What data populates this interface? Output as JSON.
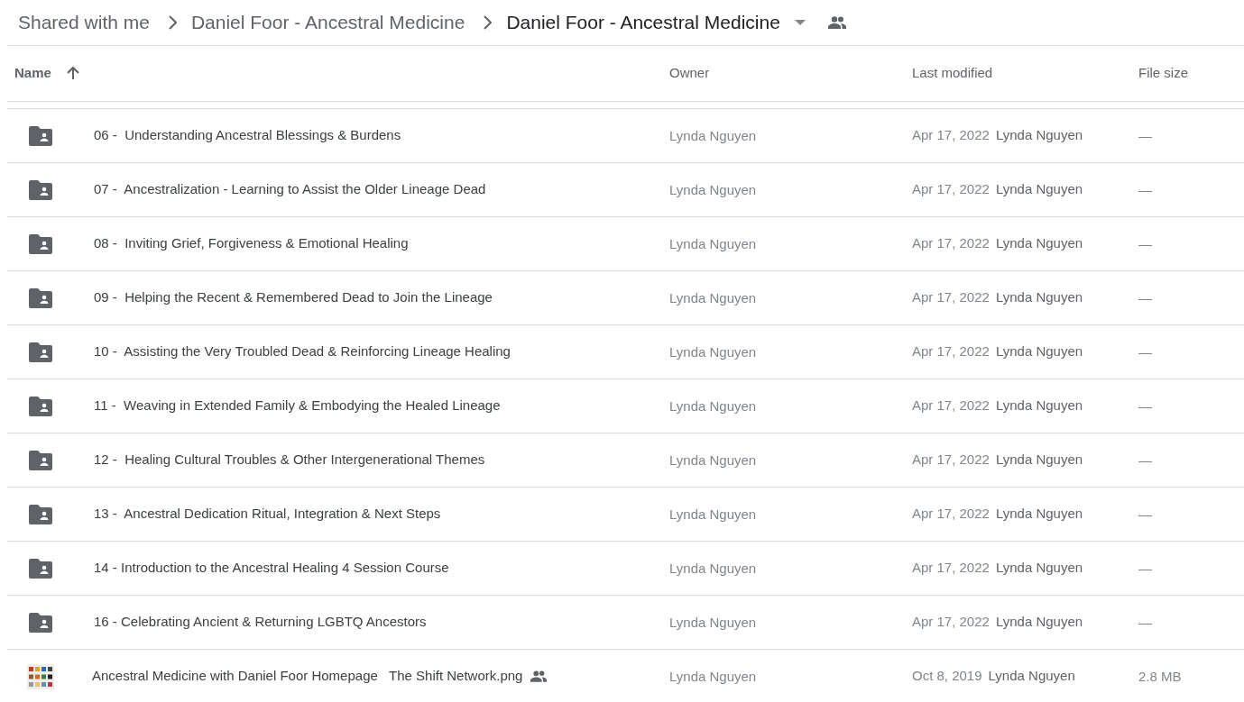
{
  "breadcrumbs": [
    {
      "label": "Shared with me",
      "current": false
    },
    {
      "label": "Daniel Foor - Ancestral Medicine",
      "current": false
    },
    {
      "label": "Daniel Foor - Ancestral Medicine",
      "current": true
    }
  ],
  "table": {
    "columns": [
      {
        "label": "Name",
        "sorted_ascending": true
      },
      {
        "label": "Owner"
      },
      {
        "label": "Last modified"
      },
      {
        "label": "File size"
      }
    ],
    "rows": [
      {
        "kind": "shared-folder",
        "name": "06 -  Understanding Ancestral Blessings & Burdens",
        "shared": false,
        "owner": "Lynda Nguyen",
        "modified": "Apr 17, 2022",
        "modified_by": "Lynda Nguyen",
        "size": "—"
      },
      {
        "kind": "shared-folder",
        "name": "07 -  Ancestralization - Learning to Assist the Older Lineage Dead",
        "shared": false,
        "owner": "Lynda Nguyen",
        "modified": "Apr 17, 2022",
        "modified_by": "Lynda Nguyen",
        "size": "—"
      },
      {
        "kind": "shared-folder",
        "name": "08 -  Inviting Grief, Forgiveness & Emotional Healing",
        "shared": false,
        "owner": "Lynda Nguyen",
        "modified": "Apr 17, 2022",
        "modified_by": "Lynda Nguyen",
        "size": "—"
      },
      {
        "kind": "shared-folder",
        "name": "09 -  Helping the Recent & Remembered Dead to Join the Lineage",
        "shared": false,
        "owner": "Lynda Nguyen",
        "modified": "Apr 17, 2022",
        "modified_by": "Lynda Nguyen",
        "size": "—"
      },
      {
        "kind": "shared-folder",
        "name": "10 -  Assisting the Very Troubled Dead & Reinforcing Lineage Healing",
        "shared": false,
        "owner": "Lynda Nguyen",
        "modified": "Apr 17, 2022",
        "modified_by": "Lynda Nguyen",
        "size": "—"
      },
      {
        "kind": "shared-folder",
        "name": "11 -  Weaving in Extended Family & Embodying the Healed Lineage",
        "shared": false,
        "owner": "Lynda Nguyen",
        "modified": "Apr 17, 2022",
        "modified_by": "Lynda Nguyen",
        "size": "—"
      },
      {
        "kind": "shared-folder",
        "name": "12 -  Healing Cultural Troubles & Other Intergenerational Themes",
        "shared": false,
        "owner": "Lynda Nguyen",
        "modified": "Apr 17, 2022",
        "modified_by": "Lynda Nguyen",
        "size": "—"
      },
      {
        "kind": "shared-folder",
        "name": "13 -  Ancestral Dedication Ritual, Integration & Next Steps",
        "shared": false,
        "owner": "Lynda Nguyen",
        "modified": "Apr 17, 2022",
        "modified_by": "Lynda Nguyen",
        "size": "—"
      },
      {
        "kind": "shared-folder",
        "name": "14 - Introduction to the Ancestral Healing 4 Session Course",
        "shared": false,
        "owner": "Lynda Nguyen",
        "modified": "Apr 17, 2022",
        "modified_by": "Lynda Nguyen",
        "size": "—"
      },
      {
        "kind": "shared-folder",
        "name": "16 - Celebrating Ancient & Returning LGBTQ Ancestors",
        "shared": false,
        "owner": "Lynda Nguyen",
        "modified": "Apr 17, 2022",
        "modified_by": "Lynda Nguyen",
        "size": "—"
      },
      {
        "kind": "image",
        "name": "Ancestral Medicine with Daniel Foor Homepage   The Shift Network.png",
        "shared": true,
        "owner": "Lynda Nguyen",
        "modified": "Oct 8, 2019",
        "modified_by": "Lynda Nguyen",
        "size": "2.8 MB"
      }
    ]
  }
}
